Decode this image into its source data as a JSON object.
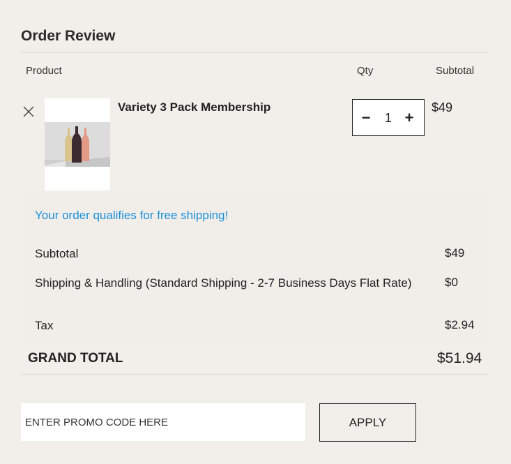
{
  "section": {
    "title": "Order Review"
  },
  "headers": {
    "product": "Product",
    "qty": "Qty",
    "subtotal": "Subtotal"
  },
  "item": {
    "name": "Variety 3 Pack Membership",
    "quantity": "1",
    "minus": "−",
    "plus": "+",
    "subtotal": "$49",
    "remove_icon": "close-icon",
    "image": "wine-bottles-thumbnail"
  },
  "shipping_message": "Your order qualifies for free shipping!",
  "summary": {
    "subtotal_label": "Subtotal",
    "subtotal_value": "$49",
    "shipping_label": "Shipping & Handling (Standard Shipping - 2-7 Business Days Flat Rate)",
    "shipping_value": "$0",
    "tax_label": "Tax",
    "tax_value": "$2.94"
  },
  "grand_total": {
    "label": "GRAND TOTAL",
    "value": "$51.94"
  },
  "promo": {
    "placeholder": "ENTER PROMO CODE HERE",
    "value": "",
    "apply_label": "APPLY"
  },
  "colors": {
    "background": "#f2efea",
    "link": "#1a8fd8",
    "text": "#222222"
  }
}
